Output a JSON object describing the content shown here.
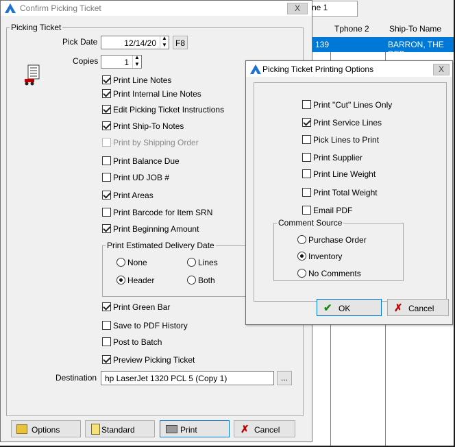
{
  "background": {
    "field_value": "ne 1",
    "columns": [
      "Tphone 2",
      "Ship-To Name"
    ],
    "selected_row": {
      "col1": "139",
      "col3": "BARRON, THE RED"
    }
  },
  "dialog": {
    "title": "Confirm Picking Ticket",
    "close": "X",
    "group_label": "Picking Ticket",
    "pick_date_label": "Pick Date",
    "pick_date_value": "12/14/20",
    "f8_label": "F8",
    "copies_label": "Copies",
    "copies_value": "1",
    "checks": [
      {
        "label": "Print Line Notes",
        "checked": true
      },
      {
        "label": "Print Internal Line Notes",
        "checked": true
      },
      {
        "label": "Edit Picking Ticket Instructions",
        "checked": true
      },
      {
        "label": "Print Ship-To Notes",
        "checked": true
      },
      {
        "label": "Print by Shipping Order",
        "checked": false,
        "disabled": true
      },
      {
        "label": "Print Balance Due",
        "checked": false
      },
      {
        "label": "Print UD JOB #",
        "checked": false
      },
      {
        "label": "Print Areas",
        "checked": true
      },
      {
        "label": "Print Barcode for Item SRN",
        "checked": false
      },
      {
        "label": "Print Beginning Amount",
        "checked": true
      }
    ],
    "delivery_group": "Print Estimated Delivery Date",
    "delivery_options": [
      "None",
      "Lines",
      "Header",
      "Both"
    ],
    "delivery_selected": "Header",
    "checks2": [
      {
        "label": "Print Green Bar",
        "checked": true
      },
      {
        "label": "Save to PDF History",
        "checked": false
      },
      {
        "label": "Post to Batch",
        "checked": false
      },
      {
        "label": "Preview Picking Ticket",
        "checked": true
      }
    ],
    "destination_label": "Destination",
    "destination_value": "hp LaserJet 1320 PCL 5 (Copy 1)",
    "ellipsis": "...",
    "buttons": {
      "options": "Options",
      "standard": "Standard",
      "print": "Print",
      "cancel": "Cancel"
    }
  },
  "options_dialog": {
    "title": "Picking Ticket Printing Options",
    "close": "X",
    "checks": [
      {
        "label": "Print \"Cut\" Lines Only",
        "checked": false
      },
      {
        "label": "Print Service Lines",
        "checked": true
      },
      {
        "label": "Pick Lines to Print",
        "checked": false
      },
      {
        "label": "Print Supplier",
        "checked": false
      },
      {
        "label": "Print Line Weight",
        "checked": false
      },
      {
        "label": "Print Total Weight",
        "checked": false
      },
      {
        "label": "Email PDF",
        "checked": false
      }
    ],
    "comment_group": "Comment Source",
    "comment_options": [
      "Purchase Order",
      "Inventory",
      "No Comments"
    ],
    "comment_selected": "Inventory",
    "ok": "OK",
    "cancel": "Cancel"
  },
  "colors": {
    "accent": "#0078d7",
    "logo": "#1e73d2",
    "cancel_x": "#c00000",
    "ok_check": "#1a8c1a"
  }
}
